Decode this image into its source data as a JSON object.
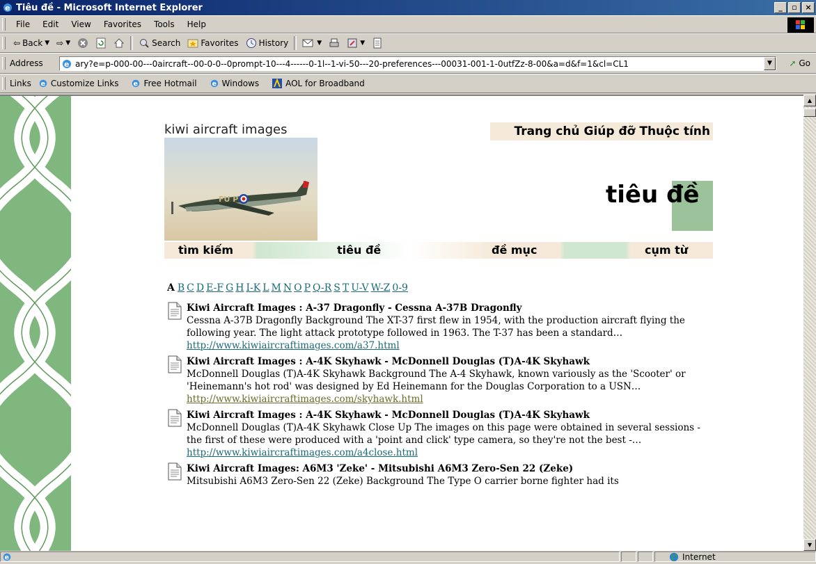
{
  "window": {
    "title": "Tiêu đề - Microsoft Internet Explorer"
  },
  "menu": [
    "File",
    "Edit",
    "View",
    "Favorites",
    "Tools",
    "Help"
  ],
  "toolbar": {
    "back": "Back",
    "search": "Search",
    "favorites": "Favorites",
    "history": "History"
  },
  "address": {
    "label": "Address",
    "value": "ary?e=p-000-00---0aircraft--00-0-0--0prompt-10---4------0-1l--1-vi-50---20-preferences---00031-001-1-0utfZz-8-00&a=d&f=1&cl=CL1",
    "go": "Go"
  },
  "links": {
    "label": "Links",
    "items": [
      "Customize Links",
      "Free Hotmail",
      "Windows",
      "AOL for Broadband"
    ]
  },
  "page": {
    "logo_text": "kiwi aircraft images",
    "plane_code": "FU P",
    "top_nav": [
      "Trang chủ",
      "Giúp đỡ",
      "Thuộc tính"
    ],
    "heading_a": "tiêu",
    "heading_b": "đề",
    "nav_tabs": [
      "tìm kiếm",
      "tiêu đề",
      "đề mục",
      "cụm từ"
    ],
    "alphabet_current": "A",
    "alphabet_links": [
      "B",
      "C",
      "D",
      "E-F",
      "G",
      "H",
      "I-K",
      "L",
      "M",
      "N",
      "O",
      "P",
      "Q-R",
      "S",
      "T",
      "U-V",
      "W-Z",
      "0-9"
    ],
    "results": [
      {
        "title": "Kiwi Aircraft Images : A-37 Dragonfly - Cessna A-37B Dragonfly",
        "snippet": "Cessna A-37B Dragonfly Background The XT-37 first flew in 1954, with the production aircraft flying the following year. The light attack prototype followed in 1963. The T-37 has been a standard…",
        "url": "http://www.kiwiaircraftimages.com/a37.html"
      },
      {
        "title": "Kiwi Aircraft Images : A-4K Skyhawk - McDonnell Douglas (T)A-4K Skyhawk",
        "snippet": "McDonnell Douglas (T)A-4K Skyhawk Background The A-4 Skyhawk, known variously as the 'Scooter' or 'Heinemann's hot rod' was designed by Ed Heinemann for the Douglas Corporation to a USN…",
        "url": "http://www.kiwiaircraftimages.com/skyhawk.html"
      },
      {
        "title": "Kiwi Aircraft Images : A-4K Skyhawk - McDonnell Douglas (T)A-4K Skyhawk",
        "snippet": "McDonnell Douglas (T)A-4K Skyhawk Close Up The images on this page were obtained in several sessions - the first of these were produced with a 'point and click' type camera, so they're not the best -…",
        "url": "http://www.kiwiaircraftimages.com/a4close.html"
      },
      {
        "title": "Kiwi Aircraft Images: A6M3 'Zeke' - Mitsubishi A6M3 Zero-Sen 22 (Zeke)",
        "snippet": "Mitsubishi A6M3 Zero-Sen 22 (Zeke) Background The Type O carrier borne fighter had its",
        "url": ""
      }
    ]
  },
  "status": {
    "zone": "Internet"
  }
}
